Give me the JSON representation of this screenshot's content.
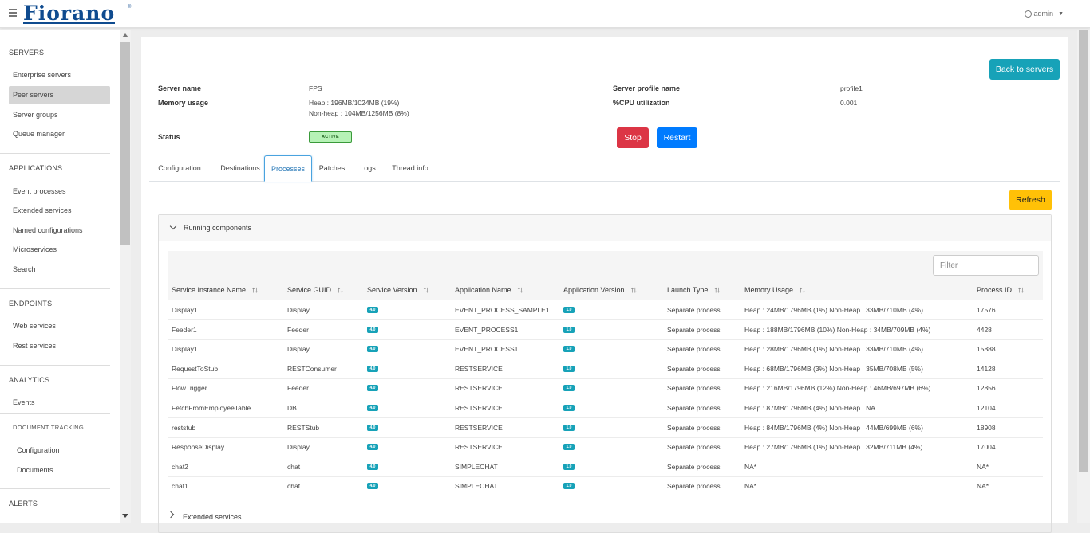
{
  "header": {
    "logo_text": "Fiorano",
    "trademark": "®",
    "user": "admin"
  },
  "sidebar": {
    "sections": [
      {
        "title": "SERVERS",
        "items": [
          "Enterprise servers",
          "Peer servers",
          "Server groups",
          "Queue manager"
        ]
      },
      {
        "title": "APPLICATIONS",
        "items": [
          "Event processes",
          "Extended services",
          "Named configurations",
          "Microservices",
          "Search"
        ]
      },
      {
        "title": "ENDPOINTS",
        "items": [
          "Web services",
          "Rest services"
        ]
      },
      {
        "title": "ANALYTICS",
        "items": [
          "Events"
        ]
      },
      {
        "title": "ALERTS",
        "items": []
      }
    ],
    "document_tracking": {
      "title": "DOCUMENT TRACKING",
      "items": [
        "Configuration",
        "Documents"
      ]
    },
    "active_item": "Peer servers"
  },
  "server": {
    "name_label": "Server name",
    "name_value": "FPS",
    "memory_label": "Memory usage",
    "heap_value": "Heap : 196MB/1024MB (19%)",
    "nonheap_value": "Non-heap : 104MB/1256MB (8%)",
    "status_label": "Status",
    "status_value": "ACTIVE",
    "profile_label": "Server profile name",
    "profile_value": "profile1",
    "cpu_label": "%CPU utilization",
    "cpu_value": "0.001"
  },
  "buttons": {
    "back": "Back to servers",
    "stop": "Stop",
    "restart": "Restart",
    "refresh": "Refresh"
  },
  "tabs": [
    "Configuration",
    "Destinations",
    "Processes",
    "Patches",
    "Logs",
    "Thread info"
  ],
  "active_tab": "Processes",
  "running_panel": {
    "title": "Running components",
    "filter_placeholder": "Filter",
    "columns": [
      "Service Instance Name",
      "Service GUID",
      "Service Version",
      "Application Name",
      "Application Version",
      "Launch Type",
      "Memory Usage",
      "Process ID"
    ],
    "rows": [
      {
        "instance": "Display1",
        "guid": "Display",
        "service_version": "4.0",
        "application": "EVENT_PROCESS_SAMPLE1",
        "app_version": "1.0",
        "launch": "Separate process",
        "memory": "Heap : 24MB/1796MB (1%) Non-Heap : 33MB/710MB (4%)",
        "pid": "17576"
      },
      {
        "instance": "Feeder1",
        "guid": "Feeder",
        "service_version": "4.0",
        "application": "EVENT_PROCESS1",
        "app_version": "1.0",
        "launch": "Separate process",
        "memory": "Heap : 188MB/1796MB (10%) Non-Heap : 34MB/709MB (4%)",
        "pid": "4428"
      },
      {
        "instance": "Display1",
        "guid": "Display",
        "service_version": "4.0",
        "application": "EVENT_PROCESS1",
        "app_version": "1.0",
        "launch": "Separate process",
        "memory": "Heap : 28MB/1796MB (1%) Non-Heap : 33MB/710MB (4%)",
        "pid": "15888"
      },
      {
        "instance": "RequestToStub",
        "guid": "RESTConsumer",
        "service_version": "4.0",
        "application": "RESTSERVICE",
        "app_version": "1.0",
        "launch": "Separate process",
        "memory": "Heap : 68MB/1796MB (3%) Non-Heap : 35MB/708MB (5%)",
        "pid": "14128"
      },
      {
        "instance": "FlowTrigger",
        "guid": "Feeder",
        "service_version": "4.0",
        "application": "RESTSERVICE",
        "app_version": "1.0",
        "launch": "Separate process",
        "memory": "Heap : 216MB/1796MB (12%) Non-Heap : 46MB/697MB (6%)",
        "pid": "12856"
      },
      {
        "instance": "FetchFromEmployeeTable",
        "guid": "DB",
        "service_version": "4.0",
        "application": "RESTSERVICE",
        "app_version": "1.0",
        "launch": "Separate process",
        "memory": "Heap : 87MB/1796MB (4%) Non-Heap : NA",
        "pid": "12104"
      },
      {
        "instance": "reststub",
        "guid": "RESTStub",
        "service_version": "4.0",
        "application": "RESTSERVICE",
        "app_version": "1.0",
        "launch": "Separate process",
        "memory": "Heap : 84MB/1796MB (4%) Non-Heap : 44MB/699MB (6%)",
        "pid": "18908"
      },
      {
        "instance": "ResponseDisplay",
        "guid": "Display",
        "service_version": "4.0",
        "application": "RESTSERVICE",
        "app_version": "1.0",
        "launch": "Separate process",
        "memory": "Heap : 27MB/1796MB (1%) Non-Heap : 32MB/711MB (4%)",
        "pid": "17004"
      },
      {
        "instance": "chat2",
        "guid": "chat",
        "service_version": "4.0",
        "application": "SIMPLECHAT",
        "app_version": "1.0",
        "launch": "Separate process",
        "memory": "NA*",
        "pid": "NA*"
      },
      {
        "instance": "chat1",
        "guid": "chat",
        "service_version": "4.0",
        "application": "SIMPLECHAT",
        "app_version": "1.0",
        "launch": "Separate process",
        "memory": "NA*",
        "pid": "NA*"
      }
    ]
  },
  "extended_panel": {
    "title": "Extended services"
  },
  "colors": {
    "primary": "#007bff",
    "danger": "#dc3545",
    "info": "#17a2b8",
    "warning": "#ffc107"
  }
}
